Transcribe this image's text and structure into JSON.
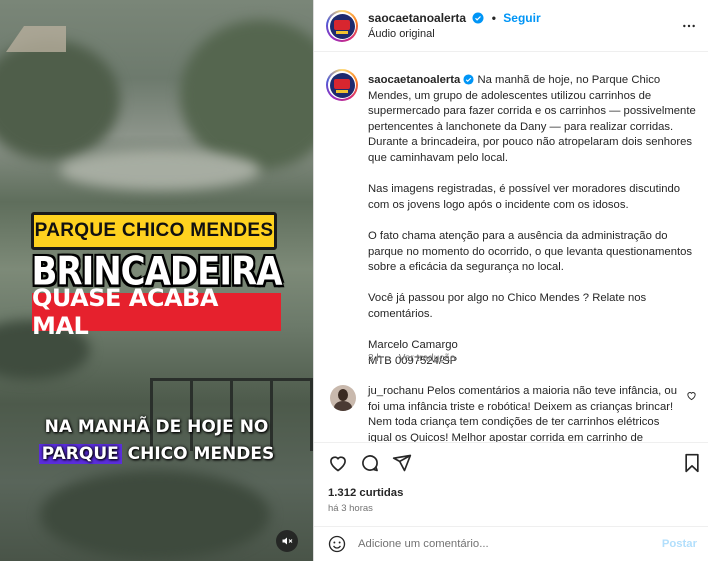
{
  "video": {
    "overlay_tag": "PARQUE CHICO MENDES",
    "overlay_title": "BRINCADEIRA",
    "overlay_subtitle": "QUASE ACABA MAL",
    "caption_line1": "NA MANHÃ DE HOJE NO",
    "caption_highlight": "PARQUE",
    "caption_rest": " CHICO MENDES",
    "colors": {
      "tag_bg": "#ffd21f",
      "subtitle_bg": "#e6212d",
      "highlight_bg": "#5a2ddb"
    },
    "mute_icon": "speaker-muted-icon"
  },
  "header": {
    "username": "saocaetanoalerta",
    "follow_label": "Seguir",
    "audio_label": "Áudio original",
    "separator": "•"
  },
  "caption": {
    "username": "saocaetanoalerta",
    "paragraphs": [
      "Na manhã de hoje, no Parque Chico Mendes, um grupo de adolescentes utilizou carrinhos de supermercado para fazer corrida e os carrinhos — possivelmente pertencentes à lanchonete da Dany — para realizar corridas. Durante a brincadeira, por pouco não atropelaram dois senhores que caminhavam pelo local.",
      "Nas imagens registradas, é possível ver moradores discutindo com os jovens logo após o incidente com os idosos.",
      "O fato chama atenção para a ausência da administração do parque no momento do ocorrido, o que levanta questionamentos sobre a eficácia da segurança no local.",
      "Você já passou por algo no Chico Mendes ? Relate nos comentários."
    ],
    "signature_name": "Marcelo Camargo",
    "signature_id": "MTB 0097524/SP",
    "age": "3 h",
    "translate_label": "Ver tradução"
  },
  "comment": {
    "username": "ju_rochanu",
    "text": "Pelos comentários a maioria não teve infância, ou foi uma infância triste e robótica! Deixem as crianças brincar! Nem toda criança tem condições de ter carrinhos elétricos igual os Quicos! Melhor apostar corrida em carrinho de"
  },
  "stats": {
    "likes": "1.312 curtidas",
    "posted": "há 3 horas"
  },
  "compose": {
    "placeholder": "Adicione um comentário...",
    "post_label": "Postar"
  }
}
